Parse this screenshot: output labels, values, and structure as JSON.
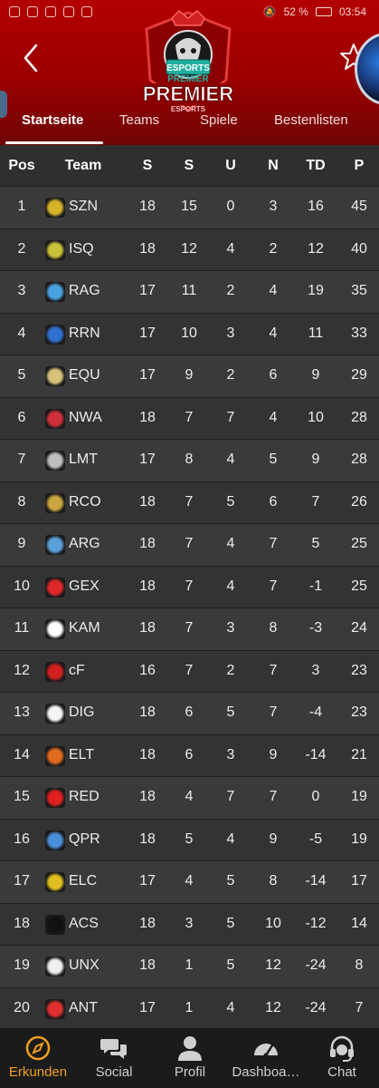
{
  "status_bar": {
    "battery": "52 %",
    "time": "03:54"
  },
  "header": {
    "logo_text_top": "ESPORTS",
    "logo_text_mid": "PREMIER",
    "logo_text_big": "PREMIER",
    "logo_text_small": "ESPORTS"
  },
  "tabs": [
    {
      "label": "Startseite",
      "active": true
    },
    {
      "label": "Teams",
      "active": false
    },
    {
      "label": "Spiele",
      "active": false
    },
    {
      "label": "Bestenlisten",
      "active": false
    }
  ],
  "table": {
    "columns": [
      "Pos",
      "Team",
      "S",
      "S",
      "U",
      "N",
      "TD",
      "P"
    ],
    "rows": [
      {
        "pos": "1",
        "team": "SZN",
        "s1": "18",
        "s2": "15",
        "u": "0",
        "n": "3",
        "td": "16",
        "p": "45",
        "logo_color": "#d6b428"
      },
      {
        "pos": "2",
        "team": "ISQ",
        "s1": "18",
        "s2": "12",
        "u": "4",
        "n": "2",
        "td": "12",
        "p": "40",
        "logo_color": "#c9c23a"
      },
      {
        "pos": "3",
        "team": "RAG",
        "s1": "17",
        "s2": "11",
        "u": "2",
        "n": "4",
        "td": "19",
        "p": "35",
        "logo_color": "#4aa3e0"
      },
      {
        "pos": "4",
        "team": "RRN",
        "s1": "17",
        "s2": "10",
        "u": "3",
        "n": "4",
        "td": "11",
        "p": "33",
        "logo_color": "#2f6fd0"
      },
      {
        "pos": "5",
        "team": "EQU",
        "s1": "17",
        "s2": "9",
        "u": "2",
        "n": "6",
        "td": "9",
        "p": "29",
        "logo_color": "#d8c27a"
      },
      {
        "pos": "6",
        "team": "NWA",
        "s1": "18",
        "s2": "7",
        "u": "7",
        "n": "4",
        "td": "10",
        "p": "28",
        "logo_color": "#d0303a"
      },
      {
        "pos": "7",
        "team": "LMT",
        "s1": "17",
        "s2": "8",
        "u": "4",
        "n": "5",
        "td": "9",
        "p": "28",
        "logo_color": "#bfbfbf"
      },
      {
        "pos": "8",
        "team": "RCO",
        "s1": "18",
        "s2": "7",
        "u": "5",
        "n": "6",
        "td": "7",
        "p": "26",
        "logo_color": "#caa640"
      },
      {
        "pos": "9",
        "team": "ARG",
        "s1": "18",
        "s2": "7",
        "u": "4",
        "n": "7",
        "td": "5",
        "p": "25",
        "logo_color": "#5aa0d8"
      },
      {
        "pos": "10",
        "team": "GEX",
        "s1": "18",
        "s2": "7",
        "u": "4",
        "n": "7",
        "td": "-1",
        "p": "25",
        "logo_color": "#e02828"
      },
      {
        "pos": "11",
        "team": "KAM",
        "s1": "18",
        "s2": "7",
        "u": "3",
        "n": "8",
        "td": "-3",
        "p": "24",
        "logo_color": "#ffffff"
      },
      {
        "pos": "12",
        "team": "cF",
        "s1": "16",
        "s2": "7",
        "u": "2",
        "n": "7",
        "td": "3",
        "p": "23",
        "logo_color": "#d02020"
      },
      {
        "pos": "13",
        "team": "DIG",
        "s1": "18",
        "s2": "6",
        "u": "5",
        "n": "7",
        "td": "-4",
        "p": "23",
        "logo_color": "#f5f5f5"
      },
      {
        "pos": "14",
        "team": "ELT",
        "s1": "18",
        "s2": "6",
        "u": "3",
        "n": "9",
        "td": "-14",
        "p": "21",
        "logo_color": "#e06a20"
      },
      {
        "pos": "15",
        "team": "RED",
        "s1": "18",
        "s2": "4",
        "u": "7",
        "n": "7",
        "td": "0",
        "p": "19",
        "logo_color": "#e02020"
      },
      {
        "pos": "16",
        "team": "QPR",
        "s1": "18",
        "s2": "5",
        "u": "4",
        "n": "9",
        "td": "-5",
        "p": "19",
        "logo_color": "#4a90d8"
      },
      {
        "pos": "17",
        "team": "ELC",
        "s1": "17",
        "s2": "4",
        "u": "5",
        "n": "8",
        "td": "-14",
        "p": "17",
        "logo_color": "#e0c020"
      },
      {
        "pos": "18",
        "team": "ACS",
        "s1": "18",
        "s2": "3",
        "u": "5",
        "n": "10",
        "td": "-12",
        "p": "14",
        "logo_color": "#111111"
      },
      {
        "pos": "19",
        "team": "UNX",
        "s1": "18",
        "s2": "1",
        "u": "5",
        "n": "12",
        "td": "-24",
        "p": "8",
        "logo_color": "#f0f0f0"
      },
      {
        "pos": "20",
        "team": "ANT",
        "s1": "17",
        "s2": "1",
        "u": "4",
        "n": "12",
        "td": "-24",
        "p": "7",
        "logo_color": "#e03030"
      }
    ]
  },
  "bottom_nav": [
    {
      "label": "Erkunden",
      "icon": "compass-icon",
      "active": true
    },
    {
      "label": "Social",
      "icon": "chat-bubbles-icon",
      "active": false
    },
    {
      "label": "Profil",
      "icon": "person-icon",
      "active": false
    },
    {
      "label": "Dashboa…",
      "icon": "speedometer-icon",
      "active": false
    },
    {
      "label": "Chat",
      "icon": "headset-icon",
      "active": false
    }
  ],
  "colors": {
    "accent": "#f0a020",
    "header_red": "#b30000",
    "row_dark": "#333333",
    "row_light": "#3a3a3a"
  }
}
